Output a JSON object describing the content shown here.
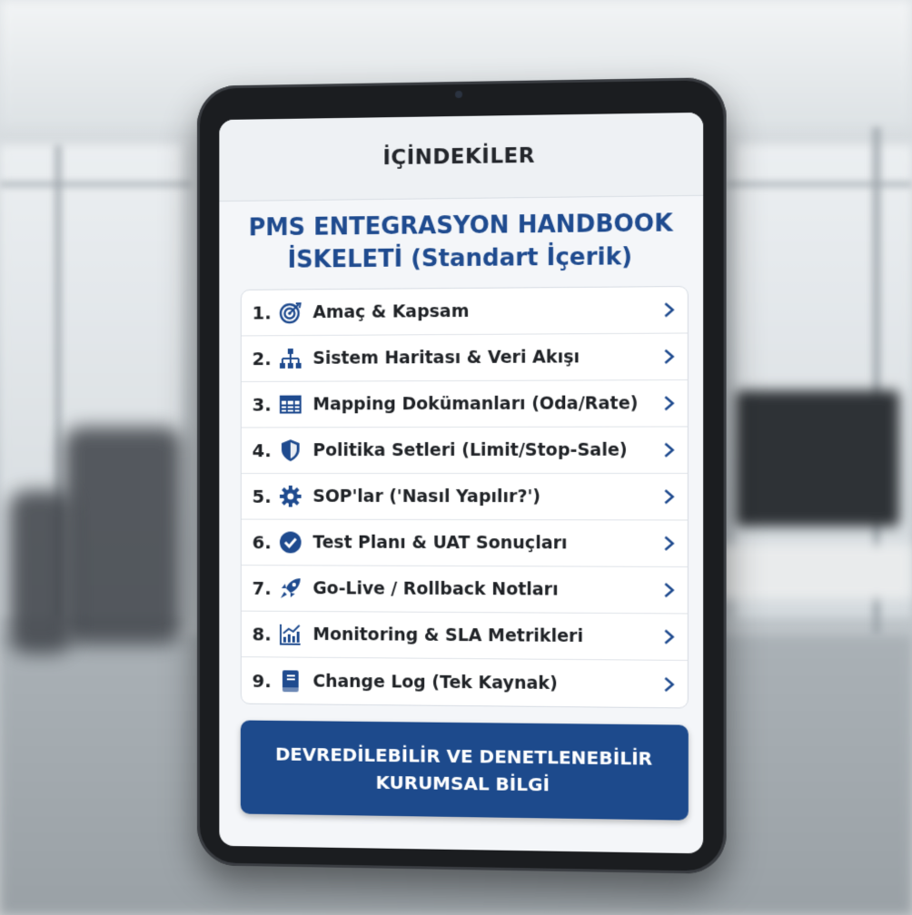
{
  "screen": {
    "header_title": "İÇİNDEKİLER",
    "doc_title_line1": "PMS ENTEGRASYON HANDBOOK",
    "doc_title_line2": "İSKELETİ (Standart İçerik)"
  },
  "toc": {
    "items": [
      {
        "number": "1.",
        "label": "Amaç & Kapsam",
        "icon": "target-icon"
      },
      {
        "number": "2.",
        "label": "Sistem Haritası & Veri Akışı",
        "icon": "sitemap-icon"
      },
      {
        "number": "3.",
        "label": "Mapping Dokümanları (Oda/Rate)",
        "icon": "table-icon"
      },
      {
        "number": "4.",
        "label": "Politika Setleri (Limit/Stop-Sale)",
        "icon": "shield-icon"
      },
      {
        "number": "5.",
        "label": "SOP'lar ('Nasıl Yapılır?')",
        "icon": "gear-icon"
      },
      {
        "number": "6.",
        "label": "Test Planı & UAT Sonuçları",
        "icon": "check-circle-icon"
      },
      {
        "number": "7.",
        "label": "Go-Live / Rollback Notları",
        "icon": "rocket-icon"
      },
      {
        "number": "8.",
        "label": "Monitoring & SLA Metrikleri",
        "icon": "chart-icon"
      },
      {
        "number": "9.",
        "label": "Change Log (Tek Kaynak)",
        "icon": "book-icon"
      }
    ]
  },
  "footer": {
    "line1": "DEVREDİLEBİLİR VE DENETLENEBİLİR",
    "line2": "KURUMSAL BİLGİ"
  },
  "colors": {
    "accent": "#1f4b8f",
    "banner": "#1d4a8c",
    "icon": "#1f4b8f"
  }
}
